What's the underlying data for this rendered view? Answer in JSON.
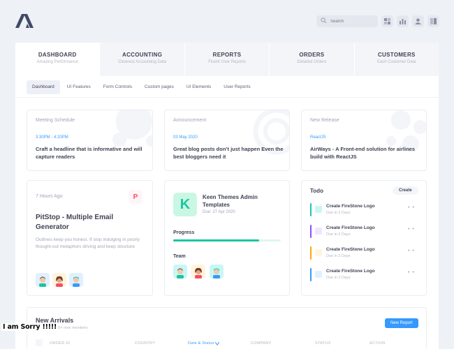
{
  "header": {
    "search_placeholder": "Search",
    "toolbar_icons": [
      "grid-icon",
      "chart-icon",
      "user-icon",
      "layout-icon"
    ]
  },
  "main_tabs": [
    {
      "label": "DASHBOARD",
      "sub": "Amazing Performance",
      "active": true
    },
    {
      "label": "ACCOUNTING",
      "sub": "Cleanest Accounting Data",
      "active": false
    },
    {
      "label": "REPORTS",
      "sub": "Fluent User Reports",
      "active": false
    },
    {
      "label": "ORDERS",
      "sub": "Detailed Orders",
      "active": false
    },
    {
      "label": "CUSTOMERS",
      "sub": "Each Customer Data",
      "active": false
    }
  ],
  "sub_nav": [
    {
      "label": "Dashboard",
      "active": true
    },
    {
      "label": "UI Features",
      "active": false
    },
    {
      "label": "Form Controls",
      "active": false
    },
    {
      "label": "Custom pages",
      "active": false
    },
    {
      "label": "UI Elements",
      "active": false
    },
    {
      "label": "User Reports",
      "active": false
    }
  ],
  "cards": {
    "meeting": {
      "label": "Meeting Schedule",
      "meta": "3:30PM - 4:20PM",
      "text": "Craft a headline that is informative and will capture readers"
    },
    "announcement": {
      "label": "Announcement",
      "meta": "03 May 2020",
      "text": "Great blog posts don’t just happen Even the best bloggers need it"
    },
    "release": {
      "label": "New Release",
      "meta": "ReactJS",
      "text": "AirWays - A Front-end solution for airlines build with ReactJS"
    }
  },
  "pitstop": {
    "time": "7 Hours Ago",
    "title": "PitStop - Multiple Email Generator",
    "desc": "Outlines keep you honest. If stop indulging in poorly thought-out metaphors driving and keep structure",
    "logo_letter": "P"
  },
  "project": {
    "logo_letter": "K",
    "title": "Keen Themes Admin Templates",
    "due": "Due: 27 Apr 2020",
    "progress_label": "Progress",
    "progress": 0.8,
    "team_label": "Team"
  },
  "todo": {
    "title": "Todo",
    "create_label": "Create",
    "items": [
      {
        "title": "Create FireStone Logo",
        "due": "Due in 2 Days",
        "color": "#1bc5bd",
        "light": "#c9f7f5"
      },
      {
        "title": "Create FireStone Logo",
        "due": "Due in 2 Days",
        "color": "#8950fc",
        "light": "#eee5ff"
      },
      {
        "title": "Create FireStone Logo",
        "due": "Due in 2 Days",
        "color": "#ffa800",
        "light": "#fff4de"
      },
      {
        "title": "Create FireStone Logo",
        "due": "Due in 2 Days",
        "color": "#3699ff",
        "light": "#e1f0ff"
      }
    ]
  },
  "new_arrivals": {
    "title": "New Arrivals",
    "subtitle": "More than 400+ new members",
    "button_label": "New Report",
    "columns": [
      "ORDER ID",
      "COUNTRY",
      "Date & Status",
      "COMPANY",
      "STATUS",
      "ACTION"
    ]
  },
  "overlay_text": "I am Sorry !!!!!",
  "colors": {
    "accent": "#3699ff",
    "success": "#1bc5a0",
    "bg": "#eef1f6"
  }
}
